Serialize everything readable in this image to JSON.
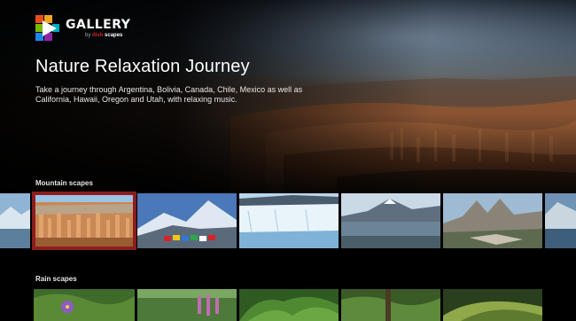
{
  "app": {
    "logo_title": "GALLERY",
    "logo_by": "by",
    "logo_brand_a": "dish",
    "logo_brand_b": "scapes"
  },
  "hero": {
    "title": "Nature Relaxation Journey",
    "description": "Take a journey through Argentina, Bolivia, Canada, Chile, Mexico as well as California, Hawaii, Oregon and Utah, with relaxing music."
  },
  "rows": [
    {
      "label": "Mountain scapes",
      "tiles": [
        {
          "name": "partial-left-tile"
        },
        {
          "name": "canyon-hoodoos",
          "focused": true
        },
        {
          "name": "snowy-peaks-prayer-flags"
        },
        {
          "name": "glacier-ice"
        },
        {
          "name": "mountain-lake"
        },
        {
          "name": "rocky-peaks"
        },
        {
          "name": "partial-right-tile"
        }
      ]
    },
    {
      "label": "Rain scapes",
      "tiles": [
        {
          "name": "purple-flower"
        },
        {
          "name": "pink-wildflowers"
        },
        {
          "name": "green-ferns"
        },
        {
          "name": "forest-leaves"
        },
        {
          "name": "palm-fronds"
        }
      ]
    }
  ],
  "colors": {
    "focus_border": "#8e1e1e",
    "brand_red": "#d6232a",
    "background": "#000000"
  }
}
